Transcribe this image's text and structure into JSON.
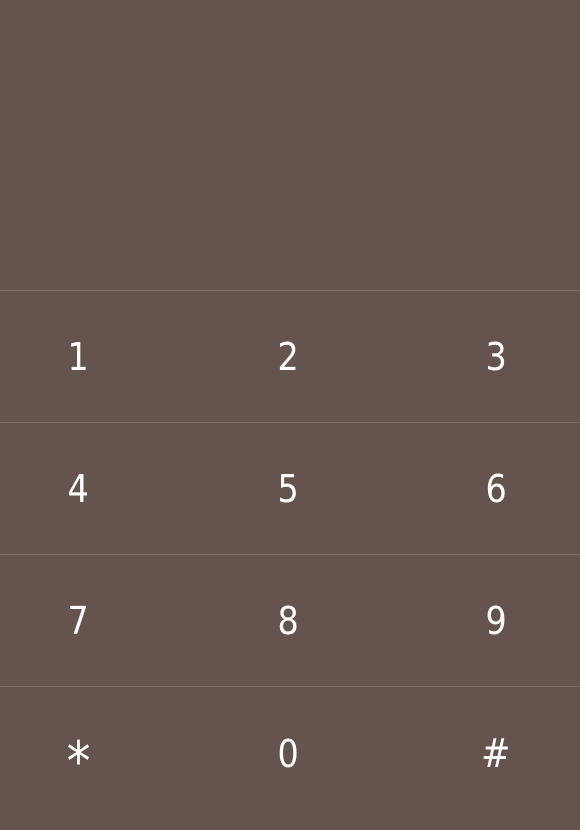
{
  "dialer": {
    "display": "",
    "keys": [
      {
        "label": "1"
      },
      {
        "label": "2"
      },
      {
        "label": "3"
      },
      {
        "label": "4"
      },
      {
        "label": "5"
      },
      {
        "label": "6"
      },
      {
        "label": "7"
      },
      {
        "label": "8"
      },
      {
        "label": "9"
      },
      {
        "label": "*"
      },
      {
        "label": "0"
      },
      {
        "label": "#"
      }
    ]
  },
  "colors": {
    "background": "#65544d",
    "divider": "#7d6e68",
    "text": "#ffffff"
  }
}
